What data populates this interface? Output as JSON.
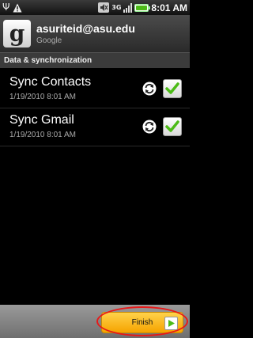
{
  "status_bar": {
    "clock": "8:01 AM",
    "network_label": "3G",
    "icons": [
      "usb-icon",
      "warning-icon",
      "mute-icon",
      "3g-icon",
      "signal-icon",
      "battery-icon"
    ]
  },
  "account": {
    "logo_letter": "g",
    "email": "asuriteid@asu.edu",
    "type": "Google"
  },
  "section": {
    "title": "Data & synchronization"
  },
  "sync_items": [
    {
      "title": "Sync Contacts",
      "date": "1/19/2010 8:01 AM",
      "checked": true
    },
    {
      "title": "Sync Gmail",
      "date": "1/19/2010 8:01 AM",
      "checked": true
    }
  ],
  "bottom": {
    "finish_label": "Finish"
  },
  "colors": {
    "accent_green": "#4cbb17",
    "button_orange": "#f5a300",
    "annotation_red": "#e81818"
  }
}
